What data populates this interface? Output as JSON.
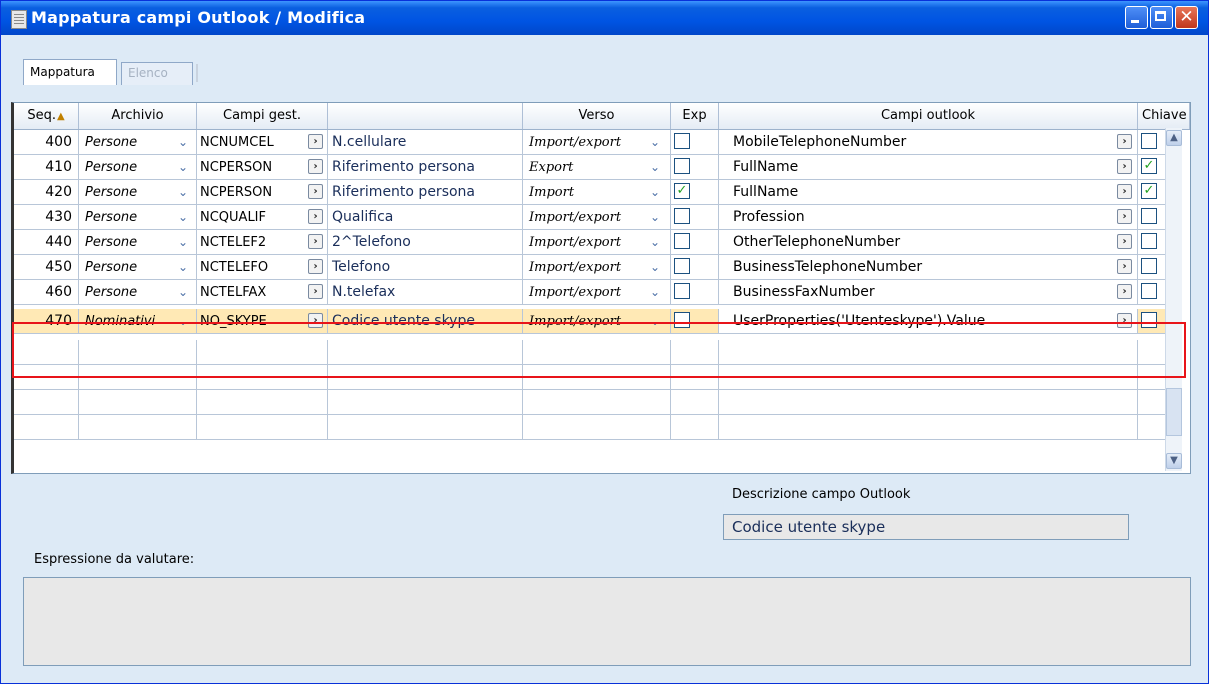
{
  "window": {
    "title": "Mappatura campi Outlook / Modifica",
    "buttons": {
      "minimize": "minimize-icon",
      "maximize": "maximize-icon",
      "close": "close-icon"
    }
  },
  "tabs": [
    {
      "label": "Mappatura",
      "active": true
    },
    {
      "label": "Elenco",
      "active": false
    }
  ],
  "grid": {
    "headers": [
      "Seq.",
      "Archivio",
      "Campi gest.",
      "",
      "Verso",
      "Exp",
      "Campi outlook",
      "Chiave"
    ],
    "rows": [
      {
        "seq": "400",
        "archivio": "Persone",
        "campo": "NCNUMCEL",
        "descrizione": "N.cellulare",
        "verso": "Import/export",
        "exp": false,
        "outlook": "MobileTelephoneNumber",
        "chiave": false
      },
      {
        "seq": "410",
        "archivio": "Persone",
        "campo": "NCPERSON",
        "descrizione": "Riferimento persona",
        "verso": "Export",
        "exp": false,
        "outlook": "FullName",
        "chiave": true
      },
      {
        "seq": "420",
        "archivio": "Persone",
        "campo": "NCPERSON",
        "descrizione": "Riferimento persona",
        "verso": "Import",
        "exp": true,
        "outlook": "FullName",
        "chiave": true
      },
      {
        "seq": "430",
        "archivio": "Persone",
        "campo": "NCQUALIF",
        "descrizione": "Qualifica",
        "verso": "Import/export",
        "exp": false,
        "outlook": "Profession",
        "chiave": false
      },
      {
        "seq": "440",
        "archivio": "Persone",
        "campo": "NCTELEF2",
        "descrizione": "2^Telefono",
        "verso": "Import/export",
        "exp": false,
        "outlook": "OtherTelephoneNumber",
        "chiave": false
      },
      {
        "seq": "450",
        "archivio": "Persone",
        "campo": "NCTELEFO",
        "descrizione": "Telefono",
        "verso": "Import/export",
        "exp": false,
        "outlook": "BusinessTelephoneNumber",
        "chiave": false
      },
      {
        "seq": "460",
        "archivio": "Persone",
        "campo": "NCTELFAX",
        "descrizione": "N.telefax",
        "verso": "Import/export",
        "exp": false,
        "outlook": "BusinessFaxNumber",
        "chiave": false
      },
      {
        "seq": "470",
        "archivio": "Nominativi",
        "campo": "NO_SKYPE",
        "descrizione": "Codice utente skype",
        "verso": "Import/export",
        "exp": false,
        "outlook": "UserProperties('Utenteskype').Value",
        "chiave": false
      }
    ]
  },
  "descrizione_outlook": {
    "label": "Descrizione campo Outlook",
    "value": "Codice utente skype"
  },
  "espressione": {
    "label": "Espressione da valutare:",
    "value": ""
  },
  "colors": {
    "title_bar": "#0054e3",
    "highlight": "#e8141a",
    "selected_row": "#ffe9b5"
  }
}
